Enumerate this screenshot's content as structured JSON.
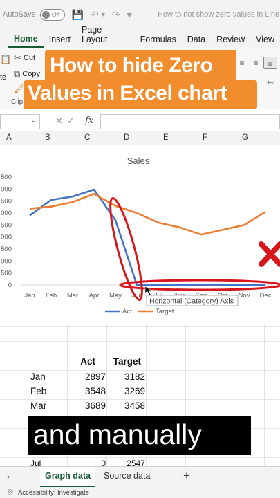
{
  "titlebar": {
    "autosave_label": "AutoSave",
    "toggle_state": "Off",
    "doc_title": "How to not show zero values in Line c"
  },
  "tabs": [
    "Home",
    "Insert",
    "Page Layout",
    "Formulas",
    "Data",
    "Review",
    "View"
  ],
  "ribbon": {
    "cut_label": "Cut",
    "copy_label": "Copy",
    "clipboard_label": "Clip",
    "paste_label": "te"
  },
  "overlay": {
    "line1": "How to hide Zero",
    "line2": "Values in Excel chart",
    "color": "#f28d2e"
  },
  "formula_bar": {
    "fx_label": "fx",
    "name_box": "",
    "formula": ""
  },
  "columns": [
    "A",
    "B",
    "C",
    "D",
    "E",
    "F",
    "G"
  ],
  "chart_data": {
    "type": "line",
    "title": "Sales",
    "categories": [
      "Jan",
      "Feb",
      "Mar",
      "Apr",
      "May",
      "Jun",
      "Jul",
      "Aug",
      "Sep",
      "Oct",
      "Nov",
      "Dec"
    ],
    "y_tick_labels": [
      "500",
      "000",
      "500",
      "000",
      "500",
      "000",
      "500",
      "000",
      "500",
      "0"
    ],
    "series": [
      {
        "name": "Act",
        "color": "#4472c4",
        "values": [
          2897,
          3548,
          3689,
          3980,
          2700,
          0,
          0,
          0,
          0,
          0,
          0,
          0
        ]
      },
      {
        "name": "Target",
        "color": "#ed7d31",
        "values": [
          3182,
          3269,
          3458,
          3800,
          3300,
          3000,
          2600,
          2400,
          2100,
          2300,
          2500,
          3050
        ]
      }
    ],
    "ylim": [
      0,
      4500
    ],
    "legend": "bottom",
    "tooltip": "Horizontal (Category) Axis",
    "annotation_color": "#d6161b"
  },
  "table": {
    "headers": [
      "Act",
      "Target"
    ],
    "rows": [
      {
        "month": "Jan",
        "act": "2897",
        "target": "3182"
      },
      {
        "month": "Feb",
        "act": "3548",
        "target": "3269"
      },
      {
        "month": "Mar",
        "act": "3689",
        "target": "3458"
      }
    ],
    "partial_row": {
      "month": "Jul",
      "act": "0",
      "target": "2547"
    }
  },
  "caption": {
    "text": "and manually"
  },
  "sheets": {
    "active": "Graph data",
    "other": "Source data",
    "add": "+"
  },
  "status": {
    "text": "Accessibility: Investigate"
  }
}
